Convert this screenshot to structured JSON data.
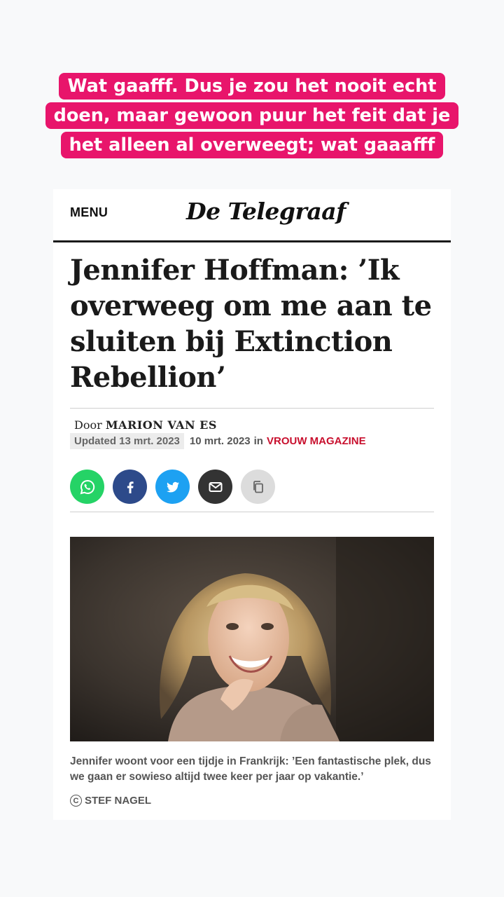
{
  "story_caption": {
    "lines": [
      "Wat gaafff. Dus je zou het nooit echt",
      "doen, maar gewoon puur het feit dat je",
      "het alleen al overweegt; wat gaaafff"
    ]
  },
  "site": {
    "menu_label": "MENU",
    "logo_text": "De Telegraaf"
  },
  "article": {
    "headline": "Jennifer Hoffman: ’Ik overweeg om me aan te sluiten bij Extinction Rebellion’",
    "byline_prefix": "Door",
    "author": "MARION VAN ES",
    "updated": "Updated 13 mrt. 2023",
    "published": "10 mrt. 2023",
    "in_label": "in",
    "section": "VROUW MAGAZINE",
    "photo_caption": "Jennifer woont voor een tijdje in Frankrijk: ’Een fantastische plek, dus we gaan er sowieso altijd twee keer per jaar op vakantie.’",
    "photo_credit": "STEF NAGEL"
  },
  "share_icons": [
    "whatsapp-icon",
    "facebook-icon",
    "twitter-icon",
    "email-icon",
    "copy-icon"
  ],
  "colors": {
    "caption_bg": "#e8156b",
    "section": "#c8102e",
    "whatsapp": "#25d366",
    "facebook": "#2d4a8a",
    "twitter": "#1da1f2"
  }
}
